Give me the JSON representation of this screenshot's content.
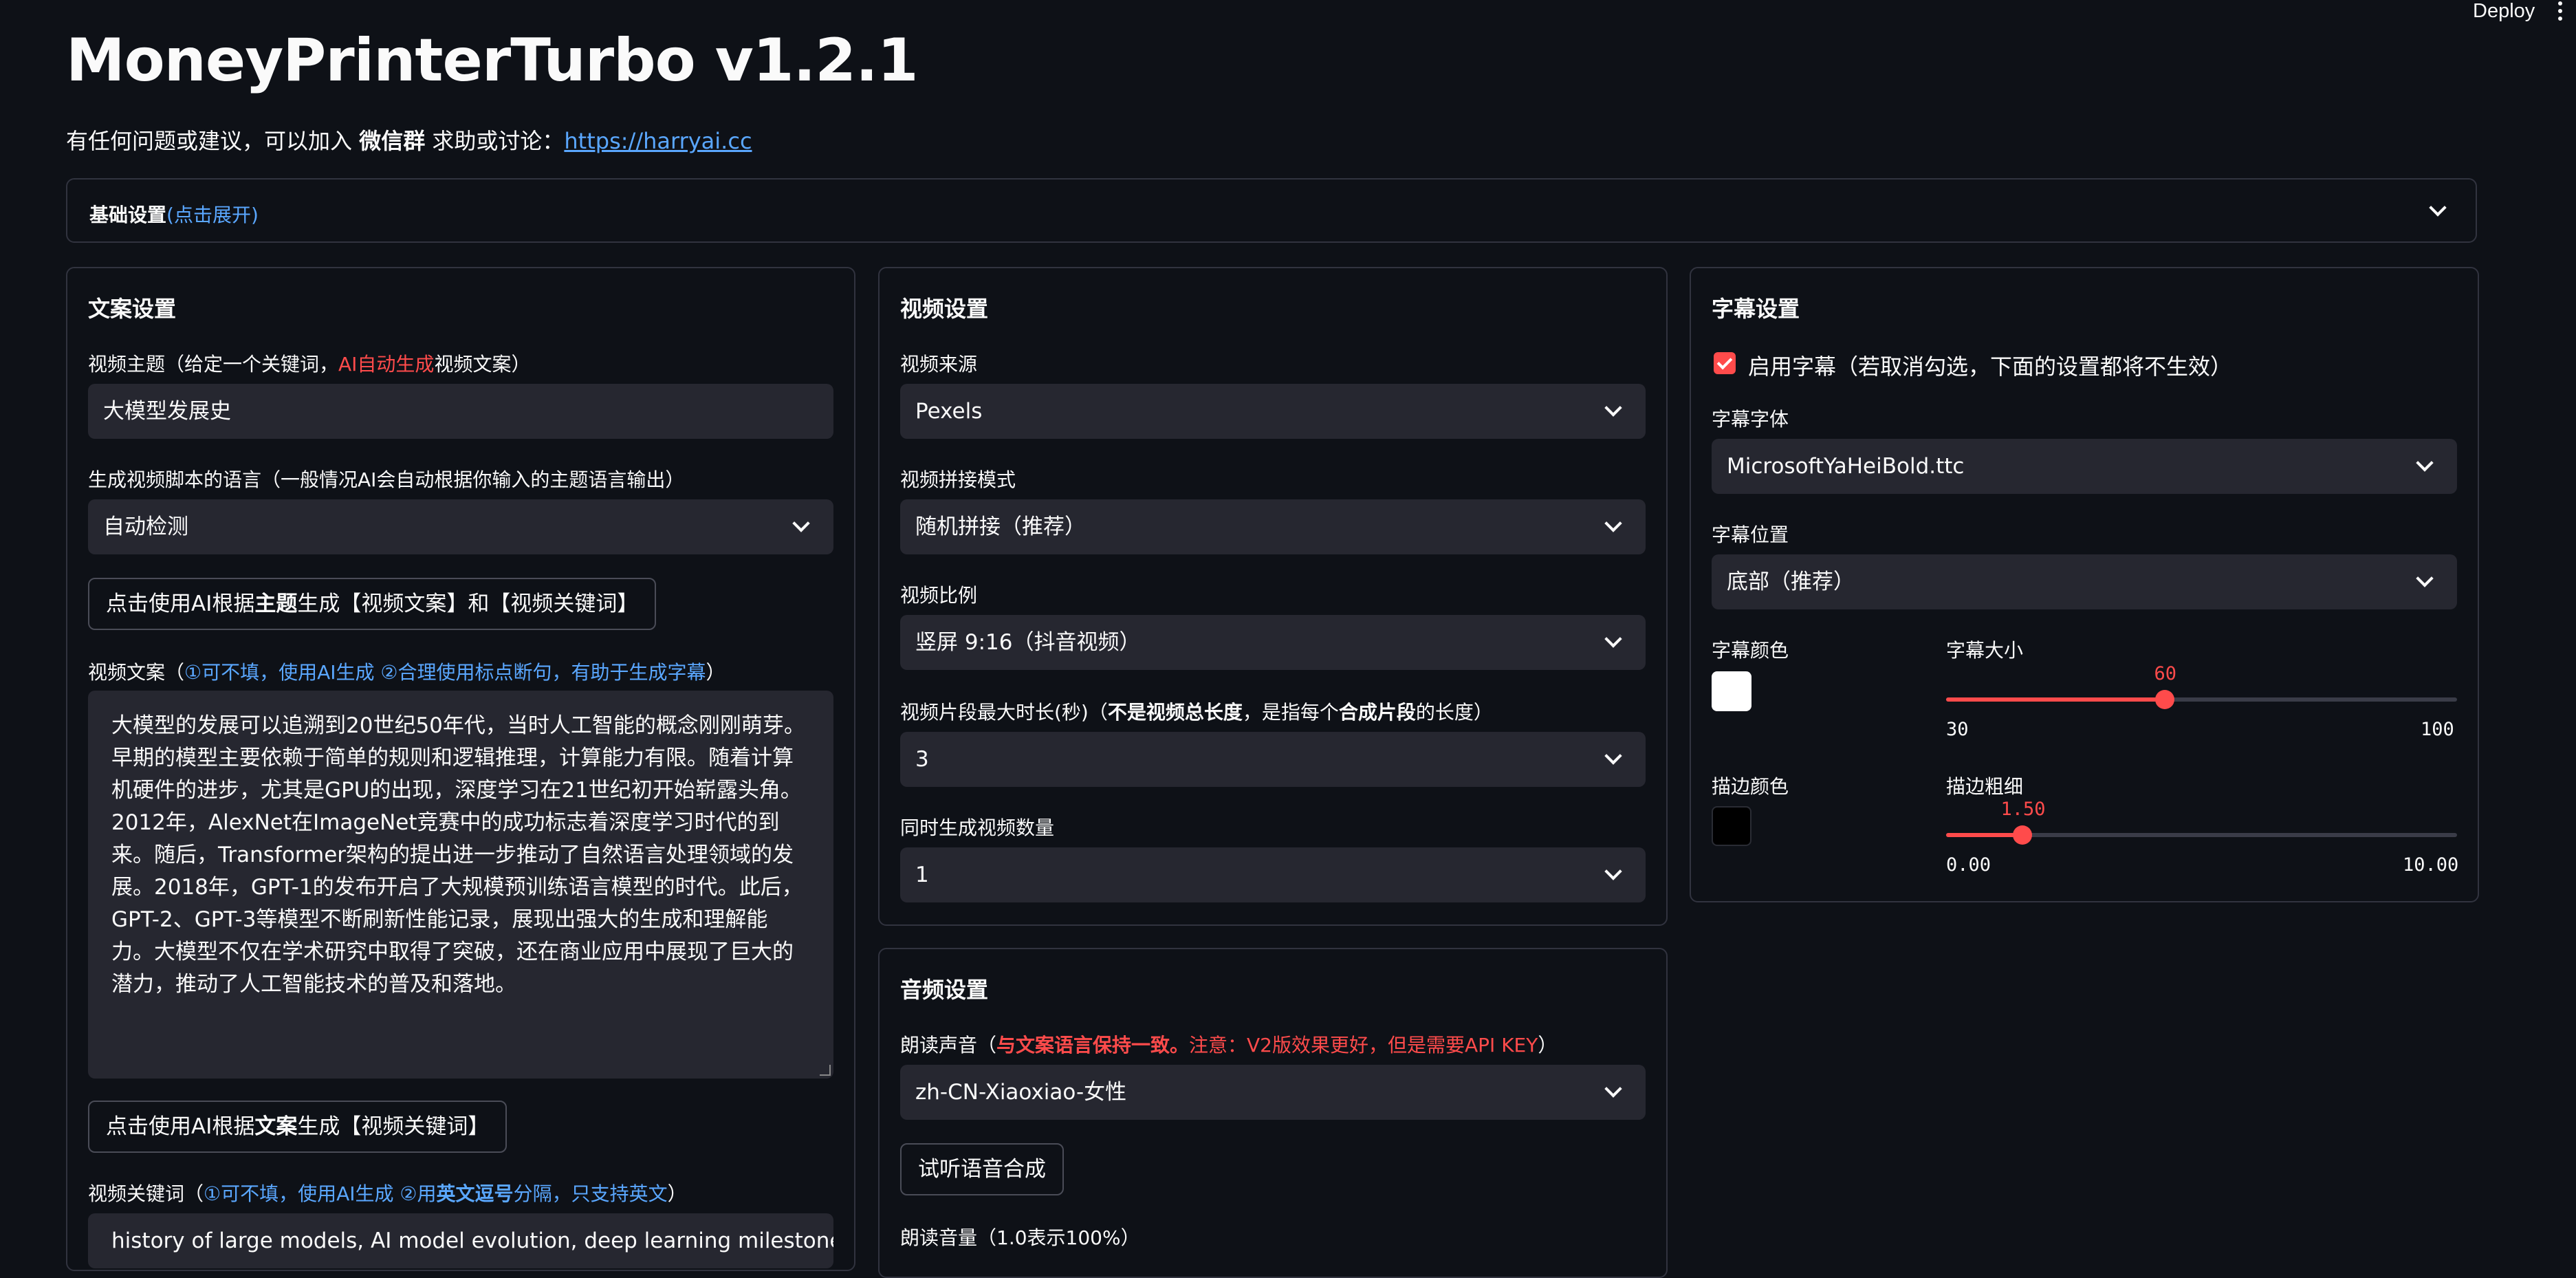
{
  "topbar": {
    "deploy_label": "Deploy"
  },
  "app": {
    "title": "MoneyPrinterTurbo v1.2.1",
    "subtitle_prefix": "有任何问题或建议，可以加入 ",
    "subtitle_bold": "微信群",
    "subtitle_mid": " 求助或讨论：",
    "subtitle_link": "https://harryai.cc"
  },
  "basic_settings": {
    "label": "基础设置",
    "hint": "(点击展开)"
  },
  "script_panel": {
    "title": "文案设置",
    "subject_label_pre": "视频主题（给定一个关键词，",
    "subject_label_red": "AI自动生成",
    "subject_label_post": "视频文案）",
    "subject_value": "大模型发展史",
    "language_label": "生成视频脚本的语言（一般情况AI会自动根据你输入的主题语言输出）",
    "language_value": "自动检测",
    "gen_btn_pre": "点击使用AI根据",
    "gen_btn_bold": "主题",
    "gen_btn_post": "生成【视频文案】和【视频关键词】",
    "script_label_pre": "视频文案（",
    "script_label_blue": "①可不填，使用AI生成  ②合理使用标点断句，有助于生成字幕",
    "script_label_post": "）",
    "script_text": "大模型的发展可以追溯到20世纪50年代，当时人工智能的概念刚刚萌芽。早期的模型主要依赖于简单的规则和逻辑推理，计算能力有限。随着计算机硬件的进步，尤其是GPU的出现，深度学习在21世纪初开始崭露头角。2012年，AlexNet在ImageNet竞赛中的成功标志着深度学习时代的到来。随后，Transformer架构的提出进一步推动了自然语言处理领域的发展。2018年，GPT-1的发布开启了大规模预训练语言模型的时代。此后，GPT-2、GPT-3等模型不断刷新性能记录，展现出强大的生成和理解能力。大模型不仅在学术研究中取得了突破，还在商业应用中展现了巨大的潜力，推动了人工智能技术的普及和落地。",
    "kw_btn_pre": "点击使用AI根据",
    "kw_btn_bold": "文案",
    "kw_btn_post": "生成【视频关键词】",
    "keywords_label_pre": "视频关键词（",
    "keywords_label_blue1": "①可不填，使用AI生成 ②用",
    "keywords_label_bold": "英文逗号",
    "keywords_label_blue2": "分隔，只支持英文",
    "keywords_label_post": "）",
    "keywords_value": "history of large models, AI model evolution, deep learning milestones, GPT"
  },
  "video_panel": {
    "title": "视频设置",
    "source_label": "视频来源",
    "source_value": "Pexels",
    "concat_label": "视频拼接模式",
    "concat_value": "随机拼接（推荐）",
    "aspect_label": "视频比例",
    "aspect_value": "竖屏 9:16（抖音视频）",
    "clip_label_pre": "视频片段最大时长(秒)（",
    "clip_label_bold1": "不是视频总长度",
    "clip_label_mid": "，是指每个",
    "clip_label_bold2": "合成片段",
    "clip_label_post": "的长度）",
    "clip_value": "3",
    "count_label": "同时生成视频数量",
    "count_value": "1"
  },
  "audio_panel": {
    "title": "音频设置",
    "voice_label_pre": "朗读声音（",
    "voice_label_red_bold": "与文案语言保持一致。",
    "voice_label_red": "注意：V2版效果更好，但是需要API KEY",
    "voice_label_post": "）",
    "voice_value": "zh-CN-Xiaoxiao-女性",
    "preview_btn": "试听语音合成",
    "volume_label": "朗读音量（1.0表示100%）"
  },
  "subtitle_panel": {
    "title": "字幕设置",
    "enable_label": "启用字幕（若取消勾选，下面的设置都将不生效）",
    "enabled": true,
    "font_label": "字幕字体",
    "font_value": "MicrosoftYaHeiBold.ttc",
    "position_label": "字幕位置",
    "position_value": "底部（推荐）",
    "color_label": "字幕颜色",
    "color_value": "#ffffff",
    "size_label": "字幕大小",
    "size_value": "60",
    "size_min": "30",
    "size_max": "100",
    "size_fraction": 0.4286,
    "stroke_color_label": "描边颜色",
    "stroke_color_value": "#000000",
    "stroke_width_label": "描边粗细",
    "stroke_width_value": "1.50",
    "stroke_width_min": "0.00",
    "stroke_width_max": "10.00",
    "stroke_width_fraction": 0.15
  },
  "colors": {
    "accent": "#ff4b4b",
    "link": "#5aa7ff",
    "background": "#0e1117",
    "input": "#262730"
  }
}
